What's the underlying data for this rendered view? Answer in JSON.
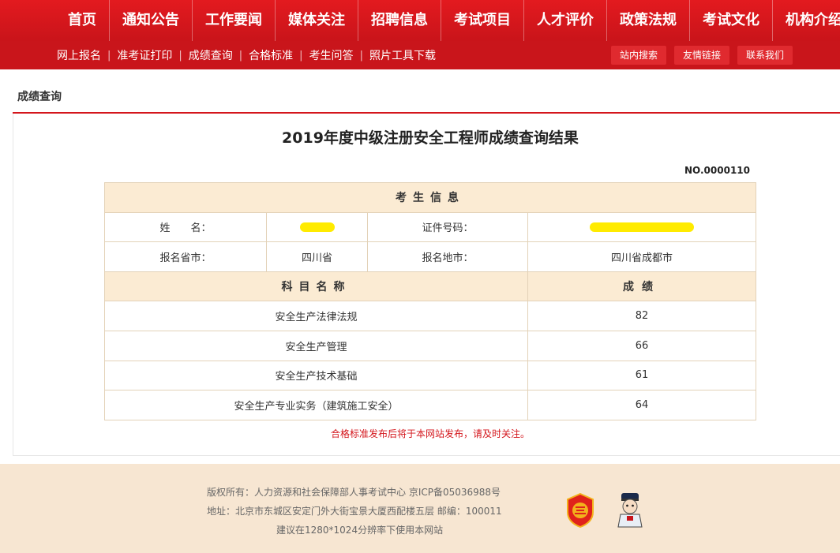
{
  "nav": {
    "top": [
      "首页",
      "通知公告",
      "工作要闻",
      "媒体关注",
      "招聘信息",
      "考试项目",
      "人才评价",
      "政策法规",
      "考试文化",
      "机构介绍"
    ],
    "sub": [
      "网上报名",
      "准考证打印",
      "成绩查询",
      "合格标准",
      "考生问答",
      "照片工具下载"
    ],
    "buttons": [
      "站内搜索",
      "友情链接",
      "联系我们"
    ]
  },
  "page": {
    "section_title": "成绩查询",
    "result_title": "2019年度中级注册安全工程师成绩查询结果",
    "cert_no": "NO.0000110",
    "notice": "合格标准发布后将于本网站发布，请及时关注。"
  },
  "table": {
    "info_header": "考生信息",
    "name_label": "姓　　名：",
    "id_label": "证件号码：",
    "province_label": "报名省市：",
    "province_value": "四川省",
    "city_label": "报名地市：",
    "city_value": "四川省成都市",
    "subject_header": "科目名称",
    "score_header": "成绩",
    "rows": [
      {
        "subject": "安全生产法律法规",
        "score": "82"
      },
      {
        "subject": "安全生产管理",
        "score": "66"
      },
      {
        "subject": "安全生产技术基础",
        "score": "61"
      },
      {
        "subject": "安全生产专业实务（建筑施工安全）",
        "score": "64"
      }
    ]
  },
  "footer": {
    "line1": "版权所有：人力资源和社会保障部人事考试中心 京ICP备05036988号",
    "line2": "地址：北京市东城区安定门外大街宝景大厦西配楼五层 邮编：100011",
    "line3": "建议在1280*1024分辨率下使用本网站"
  },
  "colors": {
    "brand_red": "#d4161c",
    "table_head": "#fbebd3",
    "redaction": "#ffeb00"
  }
}
